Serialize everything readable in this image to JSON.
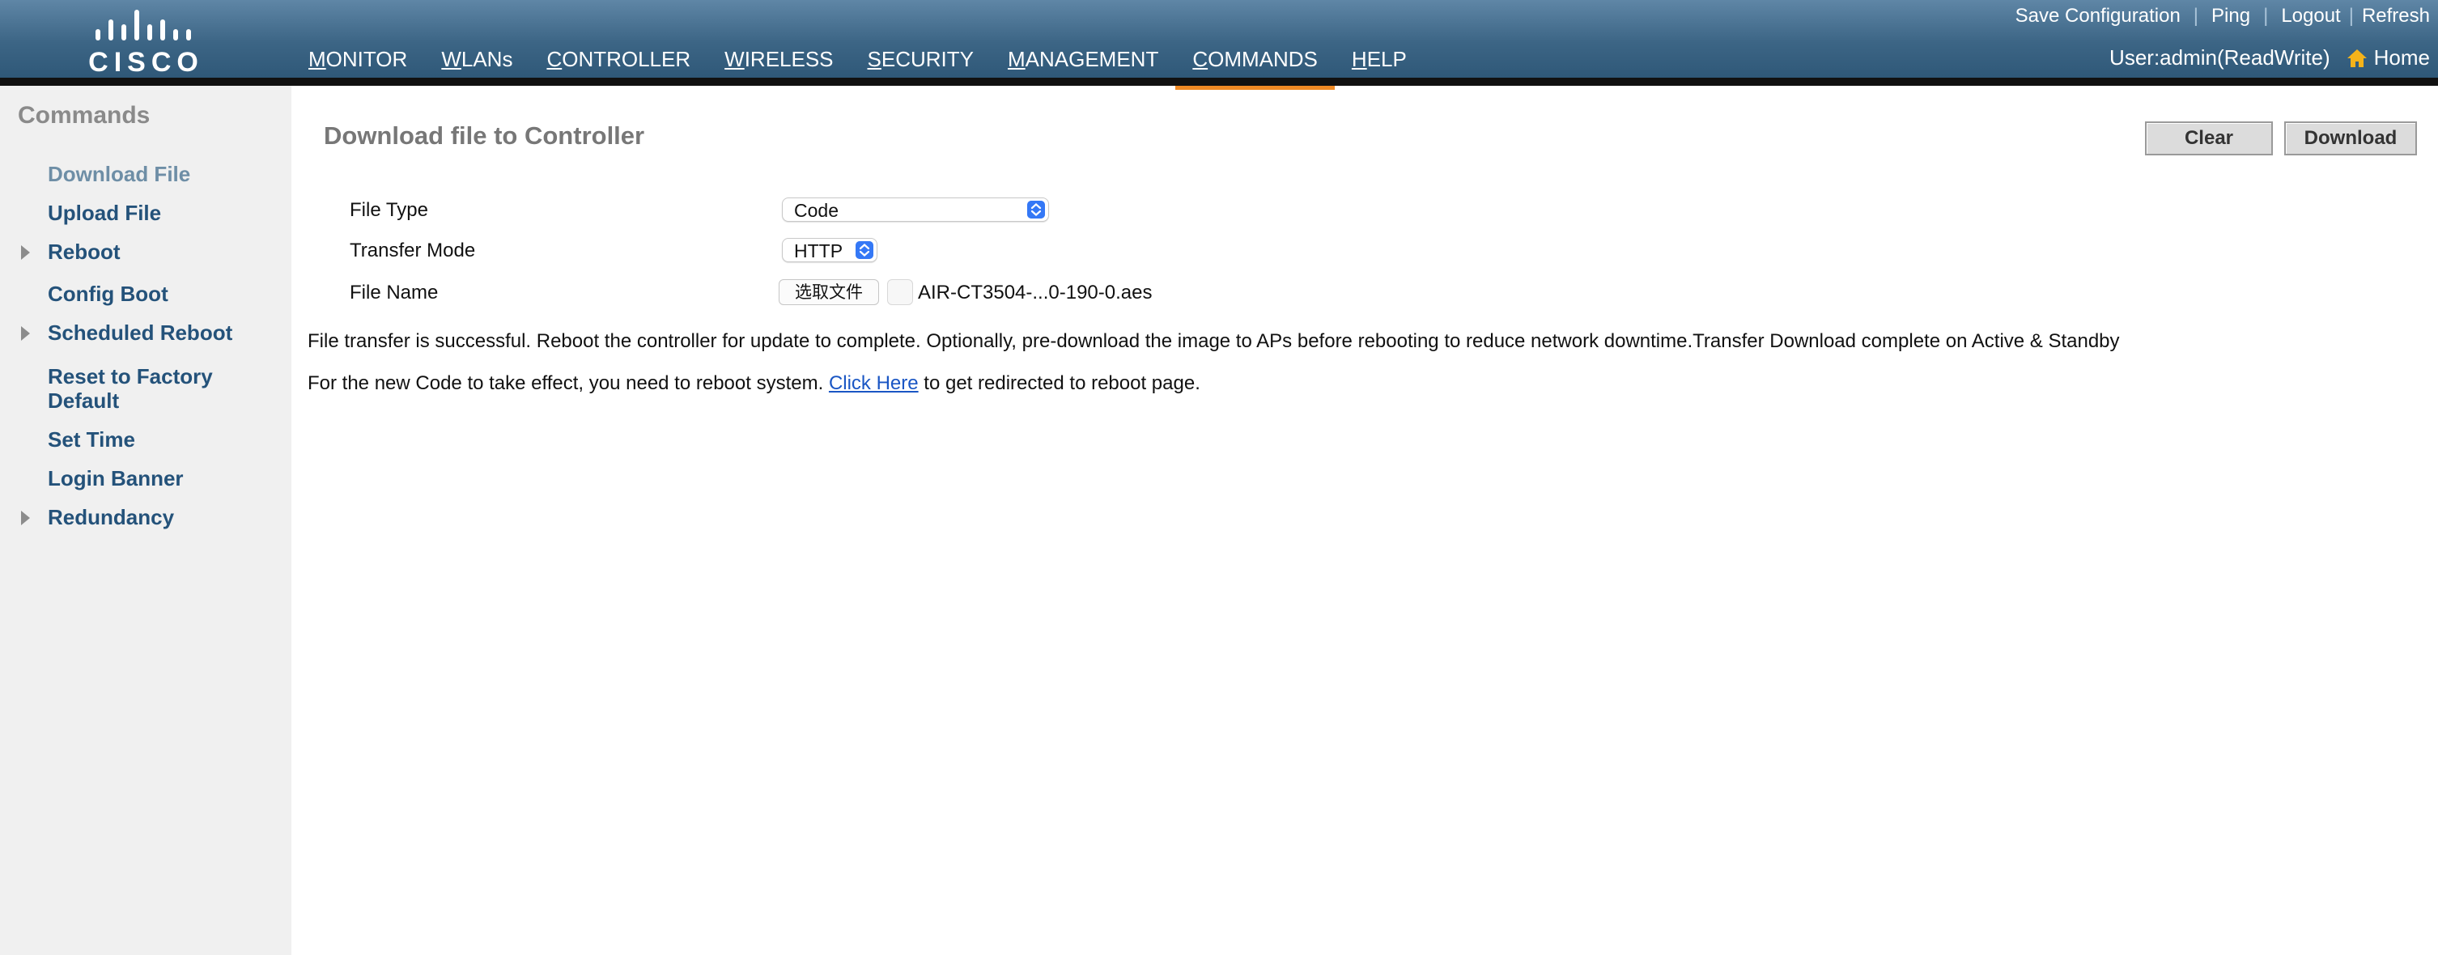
{
  "brand": {
    "logo_text": "CISCO"
  },
  "header": {
    "nav": [
      "MONITOR",
      "WLANs",
      "CONTROLLER",
      "WIRELESS",
      "SECURITY",
      "MANAGEMENT",
      "COMMANDS",
      "HELP"
    ],
    "active_nav": "COMMANDS",
    "top_links": [
      "Save Configuration",
      "Ping",
      "Logout",
      "Refresh"
    ],
    "user_text": "User:admin(ReadWrite)",
    "home_label": "Home"
  },
  "sidebar": {
    "title": "Commands",
    "items": [
      {
        "label": "Download File",
        "expandable": false,
        "current": true
      },
      {
        "label": "Upload File",
        "expandable": false
      },
      {
        "label": "Reboot",
        "expandable": true
      },
      {
        "label": "Config Boot",
        "expandable": false
      },
      {
        "label": "Scheduled Reboot",
        "expandable": true
      },
      {
        "label": "Reset to Factory Default",
        "expandable": false
      },
      {
        "label": "Set Time",
        "expandable": false
      },
      {
        "label": "Login Banner",
        "expandable": false
      },
      {
        "label": "Redundancy",
        "expandable": true
      }
    ]
  },
  "main": {
    "title": "Download file to Controller",
    "clear_label": "Clear",
    "download_label": "Download",
    "form": {
      "file_type_label": "File Type",
      "file_type_value": "Code",
      "transfer_mode_label": "Transfer Mode",
      "transfer_mode_value": "HTTP",
      "file_name_label": "File Name",
      "choose_file_label": "选取文件",
      "file_name_value": "AIR-CT3504-...0-190-0.aes"
    },
    "status_message": "File transfer is successful. Reboot the controller for update to complete. Optionally, pre-download the image to APs before rebooting to reduce network downtime.Transfer Download complete on Active & Standby",
    "reboot_prefix": "For the new Code to take effect, you need to reboot system.",
    "reboot_link": "Click Here",
    "reboot_suffix": "to get redirected to reboot page."
  },
  "colors": {
    "header": "#3c6585",
    "active_tab_underline": "#f08a24",
    "sidebar_bg": "#f0f0f0",
    "sidebar_link": "#24527a",
    "link": "#1a56c4"
  }
}
